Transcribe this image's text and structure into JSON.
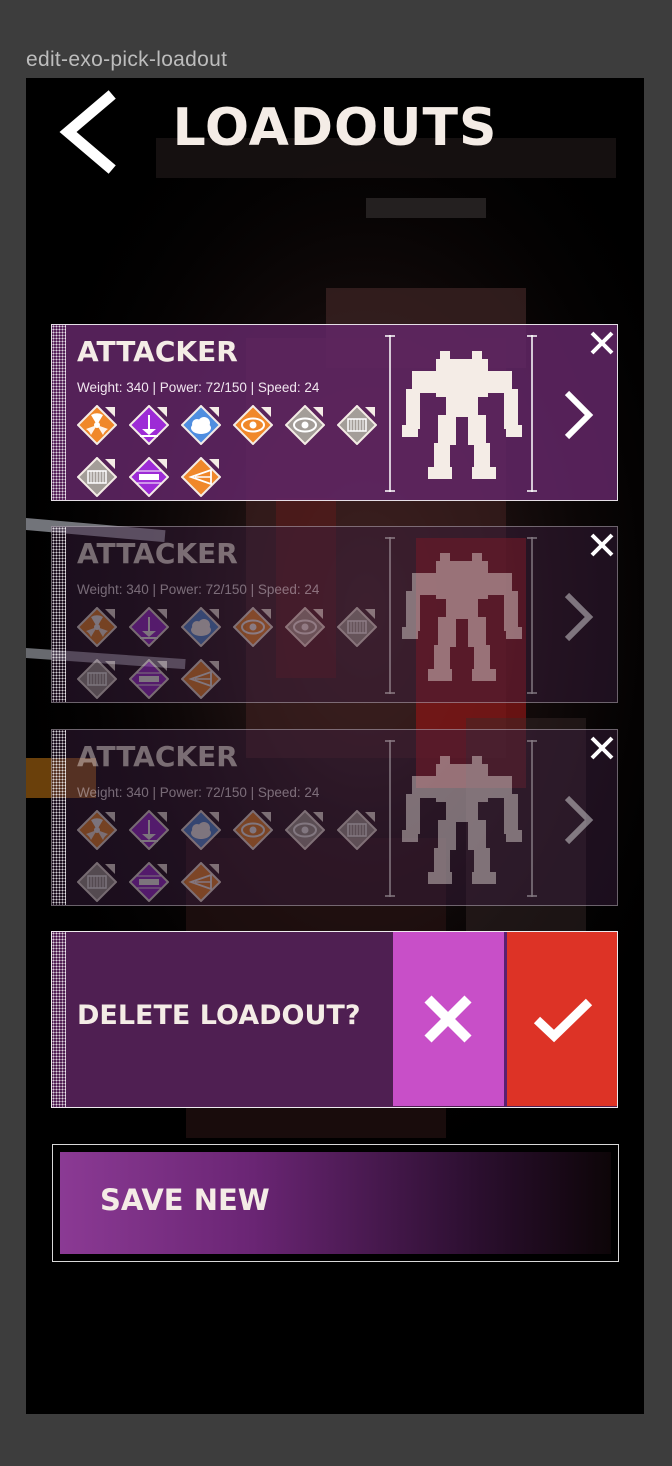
{
  "frame": {
    "label": "edit-exo-pick-loadout"
  },
  "header": {
    "title": "LOADOUTS"
  },
  "loadouts": [
    {
      "name": "ATTACKER",
      "stats": "Weight: 340 | Power: 72/150 | Speed: 24",
      "state": "active"
    },
    {
      "name": "ATTACKER",
      "stats": "Weight: 340 | Power: 72/150 | Speed: 24",
      "state": "dimmed"
    },
    {
      "name": "ATTACKER",
      "stats": "Weight: 340 | Power: 72/150 | Speed: 24",
      "state": "dimmed"
    }
  ],
  "mods": [
    {
      "icon": "radiation-icon",
      "color": "#f0882a"
    },
    {
      "icon": "drop-down-icon",
      "color": "#9d2bd6"
    },
    {
      "icon": "cloud-icon",
      "color": "#4f8ee0"
    },
    {
      "icon": "eye-icon",
      "color": "#f0882a"
    },
    {
      "icon": "eye-icon",
      "color": "#a39d98"
    },
    {
      "icon": "grille-icon",
      "color": "#a39d98"
    },
    {
      "icon": "grille-icon",
      "color": "#a39d98"
    },
    {
      "icon": "bar-icon",
      "color": "#9d2bd6"
    },
    {
      "icon": "lines-icon",
      "color": "#f0882a"
    }
  ],
  "delete_prompt": {
    "text": "DELETE LOADOUT?",
    "cancel_color": "#c84fc8",
    "confirm_color": "#dd3326"
  },
  "save_new": {
    "label": "SAVE NEW"
  },
  "colors": {
    "card_purple": "#622666",
    "text_cream": "#f4ece6",
    "background": "#000000"
  }
}
